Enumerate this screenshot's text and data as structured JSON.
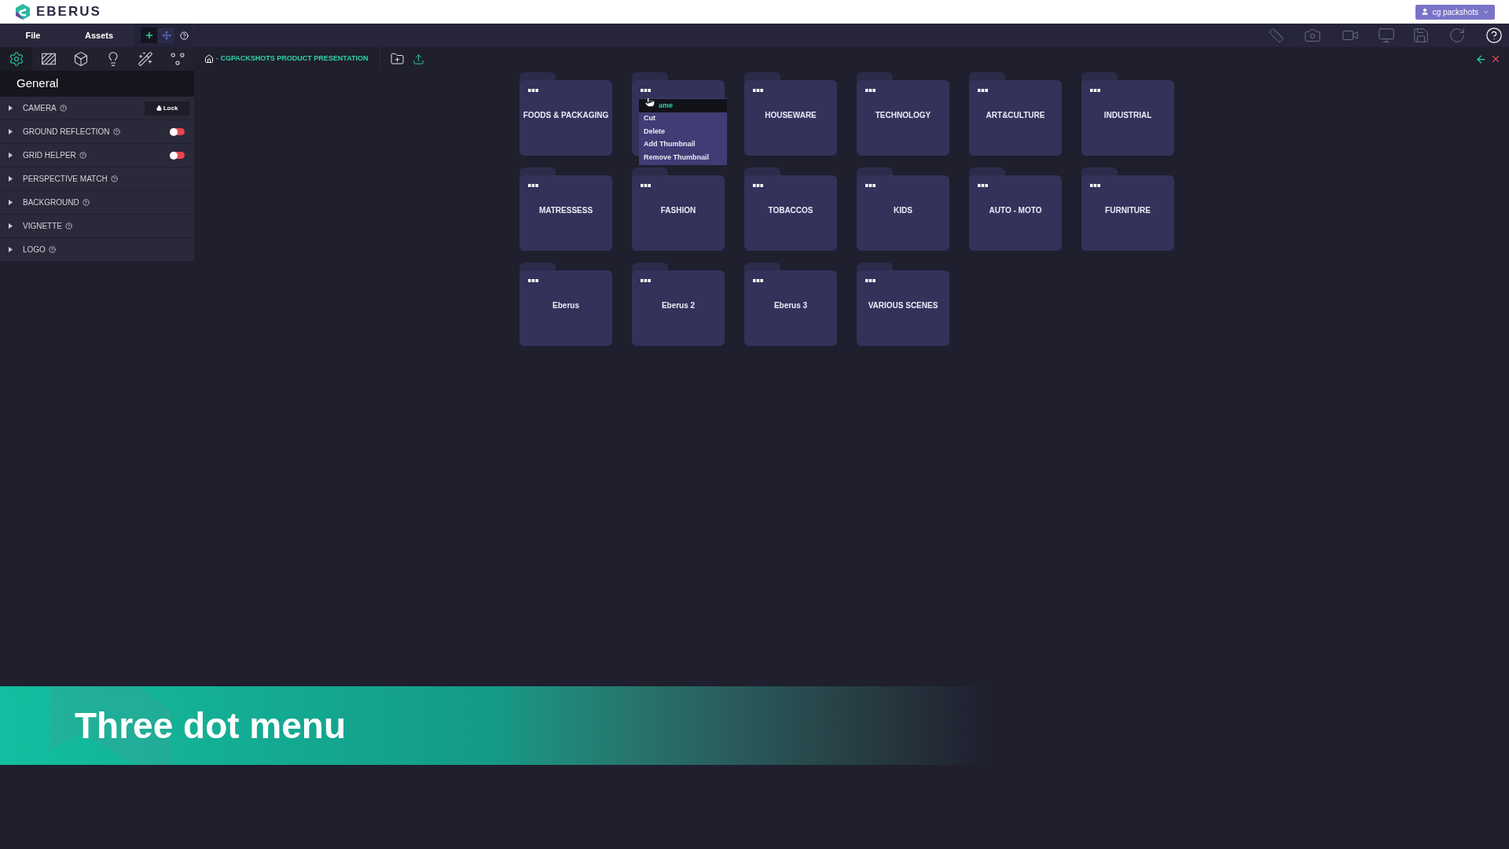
{
  "header": {
    "logo": "EBERUS",
    "user": "cg packshots"
  },
  "menu": [
    "File",
    "Assets"
  ],
  "tool_tabs": [
    {
      "selected": true
    },
    {
      "selected": false
    },
    {
      "selected": false
    },
    {
      "selected": false
    },
    {
      "selected": false
    },
    {
      "selected": false
    }
  ],
  "panel": {
    "title": "General",
    "sections": [
      {
        "label": "CAMERA",
        "kind": "lock",
        "button": "Lock"
      },
      {
        "label": "GROUND REFLECTION",
        "kind": "toggle",
        "on": false
      },
      {
        "label": "GRID HELPER",
        "kind": "toggle",
        "on": false
      },
      {
        "label": "PERSPECTIVE MATCH",
        "kind": "plain"
      },
      {
        "label": "BACKGROUND",
        "kind": "plain"
      },
      {
        "label": "VIGNETTE",
        "kind": "plain"
      },
      {
        "label": "LOGO",
        "kind": "plain"
      }
    ]
  },
  "breadcrumb": "- CGPACKSHOTS PRODUCT PRESENTATION",
  "folders": [
    {
      "title": "FOODS & PACKAGING"
    },
    {
      "menu": [
        {
          "label": "ame",
          "selected": true
        },
        {
          "label": "Cut",
          "selected": false
        },
        {
          "label": "Delete",
          "selected": false
        },
        {
          "label": "Add Thumbnail",
          "selected": false
        },
        {
          "label": "Remove Thumbnail",
          "selected": false
        }
      ]
    },
    {
      "title": "HOUSEWARE"
    },
    {
      "title": "TECHNOLOGY"
    },
    {
      "title": "ART&CULTURE"
    },
    {
      "title": "INDUSTRIAL"
    },
    {
      "title": "MATRESSESS"
    },
    {
      "title": "FASHION"
    },
    {
      "title": "TOBACCOS"
    },
    {
      "title": "KIDS"
    },
    {
      "title": "AUTO - MOTO"
    },
    {
      "title": "FURNITURE"
    },
    {
      "title": "Eberus"
    },
    {
      "title": "Eberus 2"
    },
    {
      "title": "Eberus 3"
    },
    {
      "title": "VARIOUS SCENES"
    }
  ],
  "banner": "Three dot menu"
}
